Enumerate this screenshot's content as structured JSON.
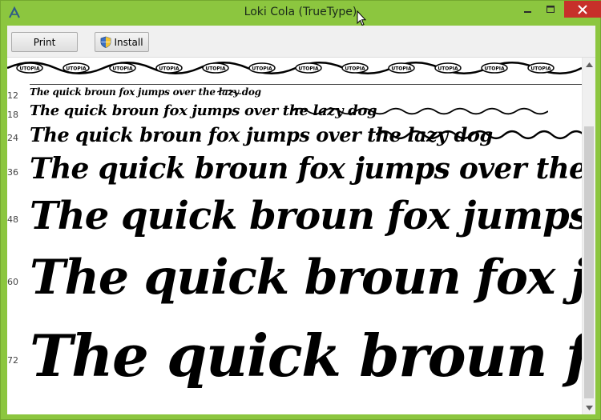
{
  "window": {
    "title": "Loki Cola (TrueType)",
    "frame_color": "#8cc63f",
    "close_color": "#c7302a"
  },
  "toolbar": {
    "print_label": "Print",
    "install_label": "Install"
  },
  "charset_line": {
    "badge_text": "UTOPIA",
    "badge_count": 12
  },
  "samples": [
    {
      "size": "12",
      "text": "The quick broun fox jumps over the lazy dog"
    },
    {
      "size": "18",
      "text": "The quick broun fox jumps over the lazy dog"
    },
    {
      "size": "24",
      "text": "The quick broun fox jumps over the lazy dog"
    },
    {
      "size": "36",
      "text": "The quick broun fox jumps over the lazy dog"
    },
    {
      "size": "48",
      "text": "The quick broun fox jumps over the lazy dog"
    },
    {
      "size": "60",
      "text": "The quick broun fox jumps over the lazy dog"
    },
    {
      "size": "72",
      "text": "The quick broun fox jumps over the lazy dog"
    }
  ]
}
